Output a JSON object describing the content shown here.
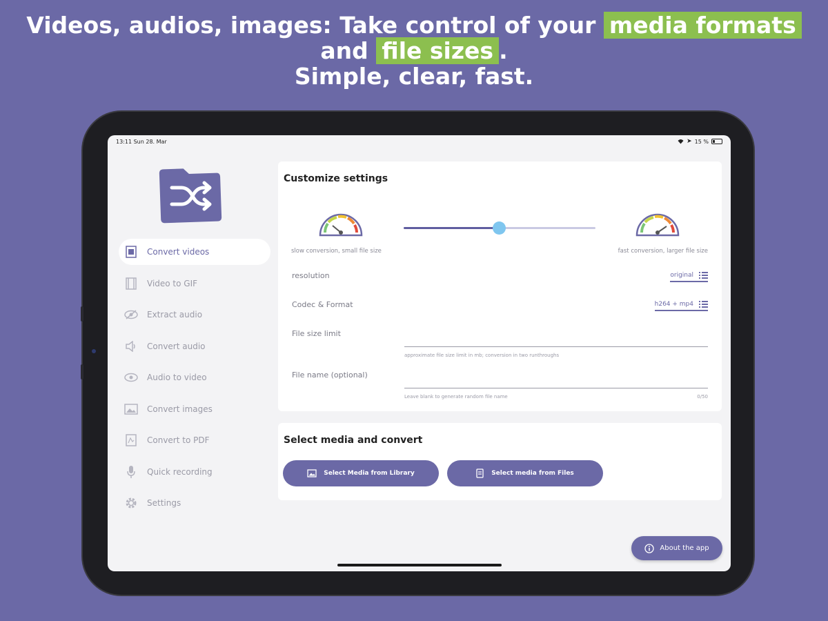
{
  "headline": {
    "line1_part1": "Videos, audios, images: Take control of your ",
    "line1_highlight": "media formats",
    "line2_part1": "and ",
    "line2_highlight": "file sizes",
    "line2_part2": ".",
    "line3": "Simple, clear, fast."
  },
  "status_bar": {
    "time": "13:11  Sun 28. Mar",
    "battery": "15 %"
  },
  "sidebar": {
    "items": [
      {
        "label": "Convert videos",
        "icon": "video-file-icon"
      },
      {
        "label": "Video to GIF",
        "icon": "film-icon"
      },
      {
        "label": "Extract audio",
        "icon": "eye-slash-icon"
      },
      {
        "label": "Convert audio",
        "icon": "speaker-icon"
      },
      {
        "label": "Audio to video",
        "icon": "eye-icon"
      },
      {
        "label": "Convert images",
        "icon": "image-icon"
      },
      {
        "label": "Convert to PDF",
        "icon": "pdf-icon"
      },
      {
        "label": "Quick recording",
        "icon": "microphone-icon"
      },
      {
        "label": "Settings",
        "icon": "gear-icon"
      }
    ]
  },
  "settings": {
    "title": "Customize settings",
    "slow_label": "slow conversion, small file size",
    "fast_label": "fast conversion, larger file size",
    "speed_value": 0.5,
    "resolution_label": "resolution",
    "resolution_value": "original",
    "codec_label": "Codec & Format",
    "codec_value": "h264 + mp4",
    "file_size_label": "File size limit",
    "file_size_hint": "approximate file size limit in mb; conversion in two runthroughs",
    "file_name_label": "File name (optional)",
    "file_name_hint": "Leave blank to generate random file name",
    "file_name_counter": "0/50"
  },
  "media": {
    "title": "Select media and convert",
    "library_button": "Select Media from Library",
    "files_button": "Select media from Files"
  },
  "about_button": "About the app",
  "colors": {
    "background": "#6b69a6",
    "highlight": "#8cbf4f",
    "accent": "#6b69a6",
    "thumb": "#7fc6ef"
  }
}
